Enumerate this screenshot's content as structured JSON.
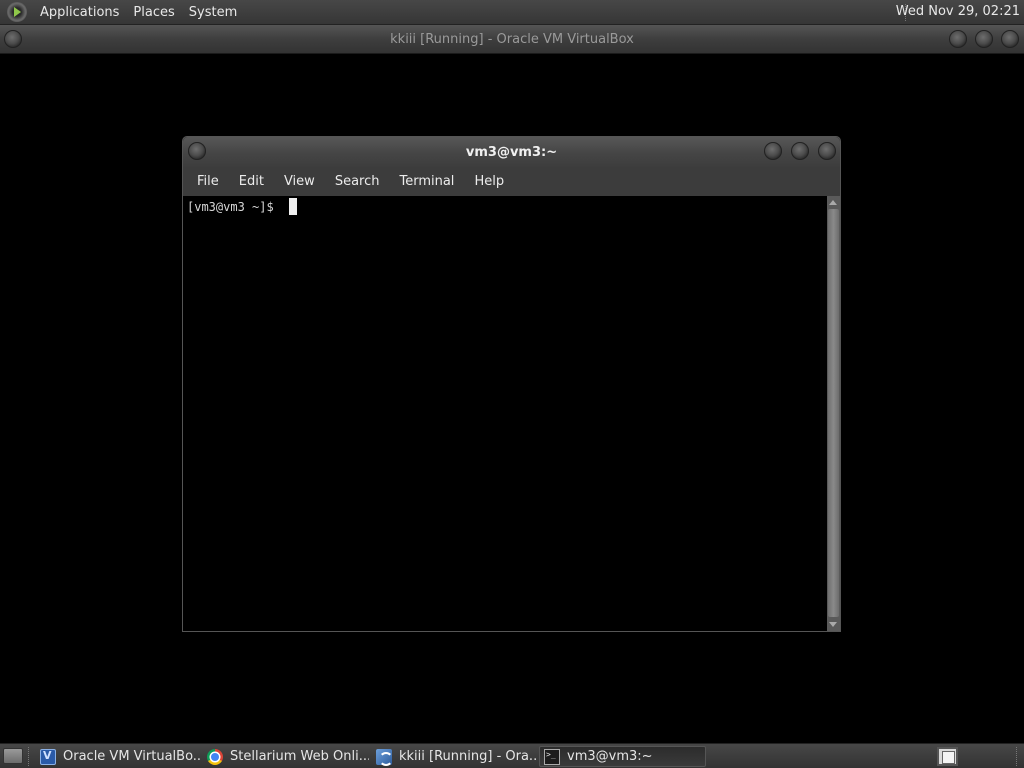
{
  "top_panel": {
    "menus": [
      "Applications",
      "Places",
      "System"
    ],
    "clock": "Wed Nov 29, 02:21"
  },
  "host_window": {
    "title": "kkiii [Running] - Oracle VM VirtualBox"
  },
  "terminal": {
    "title": "vm3@vm3:~",
    "menu": [
      "File",
      "Edit",
      "View",
      "Search",
      "Terminal",
      "Help"
    ],
    "prompt": "[vm3@vm3 ~]$ "
  },
  "taskbar": {
    "tasks": [
      {
        "label": "Oracle VM VirtualBo...",
        "icon": "virtualbox-icon",
        "active": false
      },
      {
        "label": "Stellarium Web Onli...",
        "icon": "chrome-icon",
        "active": false
      },
      {
        "label": "kkiii [Running] - Ora...",
        "icon": "virtualbox-running-icon",
        "active": false
      },
      {
        "label": "vm3@vm3:~",
        "icon": "terminal-icon",
        "active": true
      }
    ]
  },
  "colors": {
    "desktop": "#000000",
    "panel": "#3d3d3d",
    "terminal_bg": "#000000",
    "terminal_fg": "#d7d7d7"
  }
}
